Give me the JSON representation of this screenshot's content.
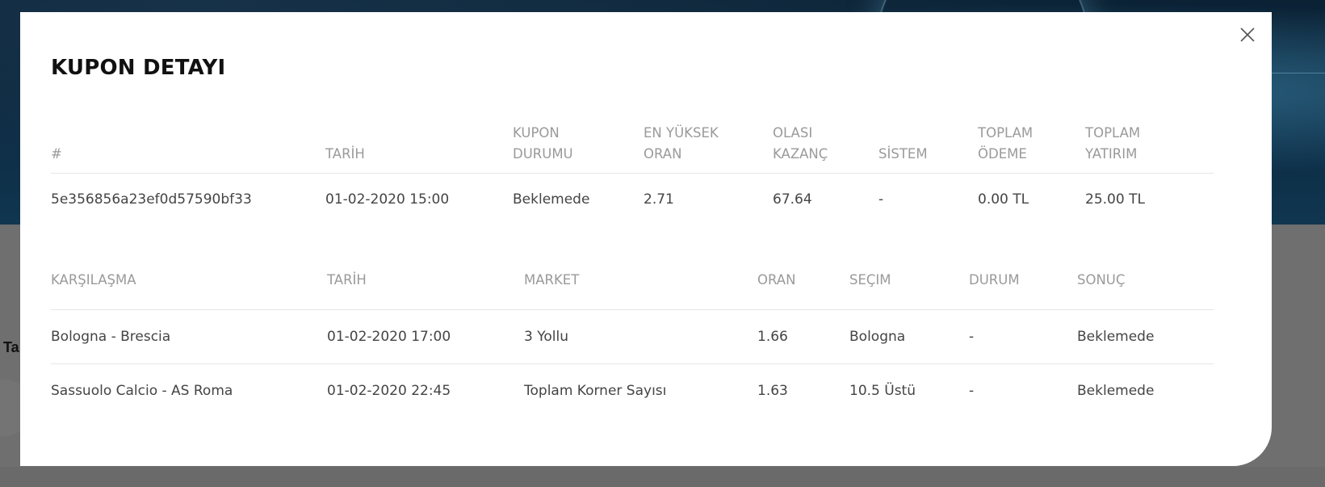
{
  "background": {
    "stub_text": "Ta"
  },
  "modal": {
    "title": "KUPON DETAYI",
    "close_icon": "close-icon"
  },
  "coupon": {
    "headers": [
      {
        "line1": "",
        "line2": "#"
      },
      {
        "line1": "",
        "line2": "TARİH"
      },
      {
        "line1": "KUPON",
        "line2": "DURUMU"
      },
      {
        "line1": "EN YÜKSEK",
        "line2": "ORAN"
      },
      {
        "line1": "OLASI",
        "line2": "KAZANÇ"
      },
      {
        "line1": "",
        "line2": "SİSTEM"
      },
      {
        "line1": "TOPLAM",
        "line2": "ÖDEME"
      },
      {
        "line1": "TOPLAM",
        "line2": "YATIRIM"
      }
    ],
    "row": {
      "id": "5e356856a23ef0d57590bf33",
      "date": "01-02-2020 15:00",
      "status": "Beklemede",
      "max_odds": "2.71",
      "potential_win": "67.64",
      "system": "-",
      "total_payment": "0.00 TL",
      "total_stake": "25.00 TL"
    }
  },
  "matches": {
    "headers": [
      "KARŞILAŞMA",
      "TARİH",
      "MARKET",
      "ORAN",
      "SEÇIM",
      "DURUM",
      "SONUÇ"
    ],
    "rows": [
      {
        "match": "Bologna - Brescia",
        "date": "01-02-2020 17:00",
        "market": "3 Yollu",
        "odds": "1.66",
        "selection": "Bologna",
        "status": "-",
        "result": "Beklemede"
      },
      {
        "match": "Sassuolo Calcio - AS Roma",
        "date": "01-02-2020 22:45",
        "market": "Toplam Korner Sayısı",
        "odds": "1.63",
        "selection": "10.5 Üstü",
        "status": "-",
        "result": "Beklemede"
      }
    ]
  }
}
